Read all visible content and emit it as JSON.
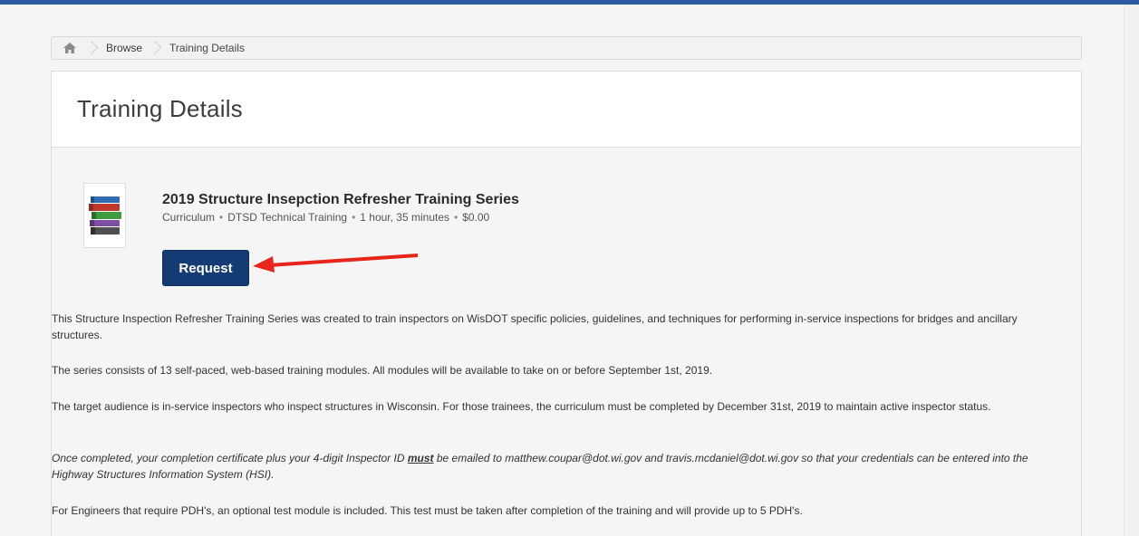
{
  "breadcrumb": {
    "home_icon": "home-icon",
    "items": [
      "Browse",
      "Training Details"
    ]
  },
  "page": {
    "title": "Training Details"
  },
  "course": {
    "thumbnail_icon": "books-icon",
    "title": "2019 Structure Insepction Refresher Training Series",
    "type": "Curriculum",
    "provider": "DTSD Technical Training",
    "duration": "1 hour, 35 minutes",
    "price": "$0.00",
    "request_label": "Request"
  },
  "description": {
    "p1": "This Structure Inspection Refresher Training Series was created to train inspectors on WisDOT specific policies, guidelines, and techniques for performing in-service inspections for bridges and ancillary structures.",
    "p2": "The series consists of 13 self-paced, web-based training modules. All modules will be available to take on or before September 1st, 2019.",
    "p3": "The target audience is in-service inspectors who inspect structures in Wisconsin.  For those trainees, the curriculum must be completed by December 31st, 2019 to maintain active inspector status.",
    "p4_before": "Once completed, your completion certificate plus your 4-digit Inspector ID ",
    "p4_must": "must",
    "p4_after": " be emailed to matthew.coupar@dot.wi.gov and travis.mcdaniel@dot.wi.gov so that your credentials can be entered into the Highway Structures Information System (HSI).",
    "p5": "For Engineers that require PDH's, an optional test module is included. This test must be taken after completion of the training and will provide up to 5 PDH's."
  },
  "colors": {
    "accent": "#143b73",
    "arrow": "#e8251b",
    "topbar": "#2c5aa0"
  }
}
